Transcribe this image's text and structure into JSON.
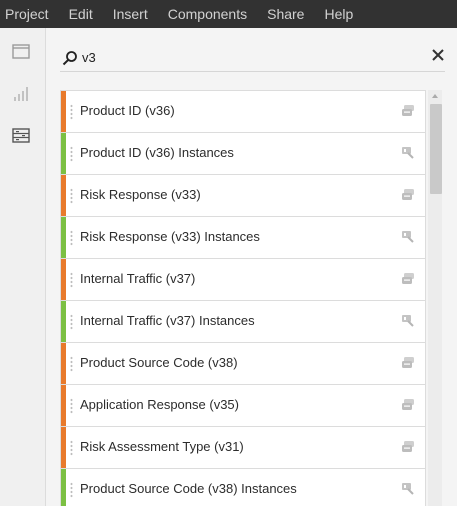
{
  "menu": [
    "Project",
    "Edit",
    "Insert",
    "Components",
    "Share",
    "Help"
  ],
  "rail": {
    "items": [
      {
        "name": "panels-icon"
      },
      {
        "name": "visualizations-icon"
      },
      {
        "name": "components-icon",
        "active": true
      }
    ]
  },
  "search": {
    "value": "v3"
  },
  "colors": {
    "dimension": "#e87a2c",
    "segment": "#7cc043",
    "menubar": "#323232"
  },
  "list": [
    {
      "label": "Product ID (v36)",
      "kind": "dimension",
      "icon": "dimension-icon"
    },
    {
      "label": "Product ID (v36) Instances",
      "kind": "metric",
      "icon": "metric-icon"
    },
    {
      "label": "Risk Response (v33)",
      "kind": "dimension",
      "icon": "dimension-icon"
    },
    {
      "label": "Risk Response (v33) Instances",
      "kind": "metric",
      "icon": "metric-icon"
    },
    {
      "label": "Internal Traffic (v37)",
      "kind": "dimension",
      "icon": "dimension-icon"
    },
    {
      "label": "Internal Traffic (v37) Instances",
      "kind": "metric",
      "icon": "metric-icon"
    },
    {
      "label": "Product Source Code (v38)",
      "kind": "dimension",
      "icon": "dimension-icon"
    },
    {
      "label": "Application Response (v35)",
      "kind": "dimension",
      "icon": "dimension-icon"
    },
    {
      "label": "Risk Assessment Type (v31)",
      "kind": "dimension",
      "icon": "dimension-icon"
    },
    {
      "label": "Product Source Code (v38) Instances",
      "kind": "metric",
      "icon": "metric-icon"
    }
  ]
}
